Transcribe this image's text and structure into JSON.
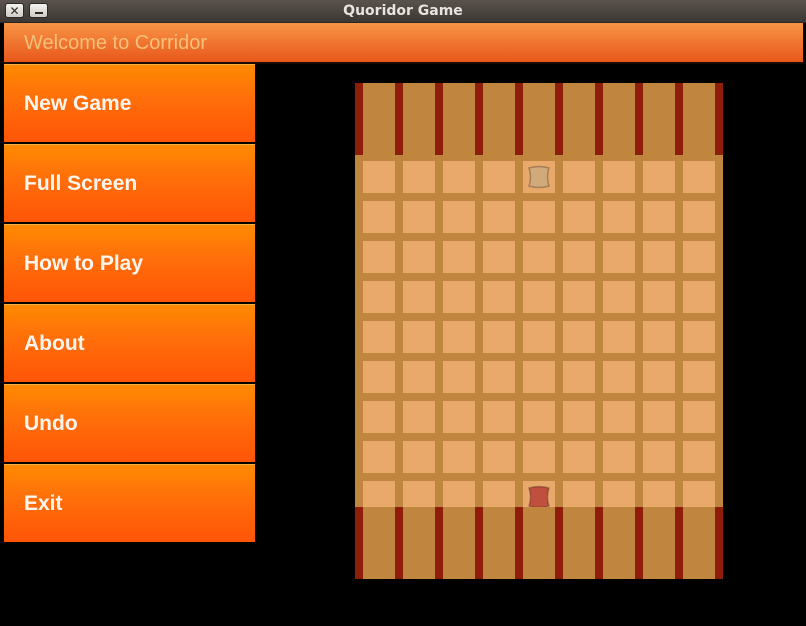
{
  "window": {
    "title": "Quoridor Game",
    "close_glyph": "✕",
    "minimize_icon": "minimize-icon"
  },
  "header": {
    "text": "Welcome to Corridor"
  },
  "menu": {
    "items": [
      {
        "label": "New Game"
      },
      {
        "label": "Full Screen"
      },
      {
        "label": "How to Play"
      },
      {
        "label": "About"
      },
      {
        "label": "Undo"
      },
      {
        "label": "Exit"
      }
    ]
  },
  "board": {
    "rows": 9,
    "cols": 9,
    "wall_slots_per_strip": 10,
    "colors": {
      "cell": "#e8a96a",
      "gutter": "#c0853e",
      "wall": "#8e1d09",
      "accent": "#ff6e0a"
    },
    "pawns": [
      {
        "name": "player-1-pawn",
        "row": 0,
        "col": 4,
        "color": "#d2a97a"
      },
      {
        "name": "player-2-pawn",
        "row": 8,
        "col": 4,
        "color": "#c0503e"
      }
    ]
  }
}
